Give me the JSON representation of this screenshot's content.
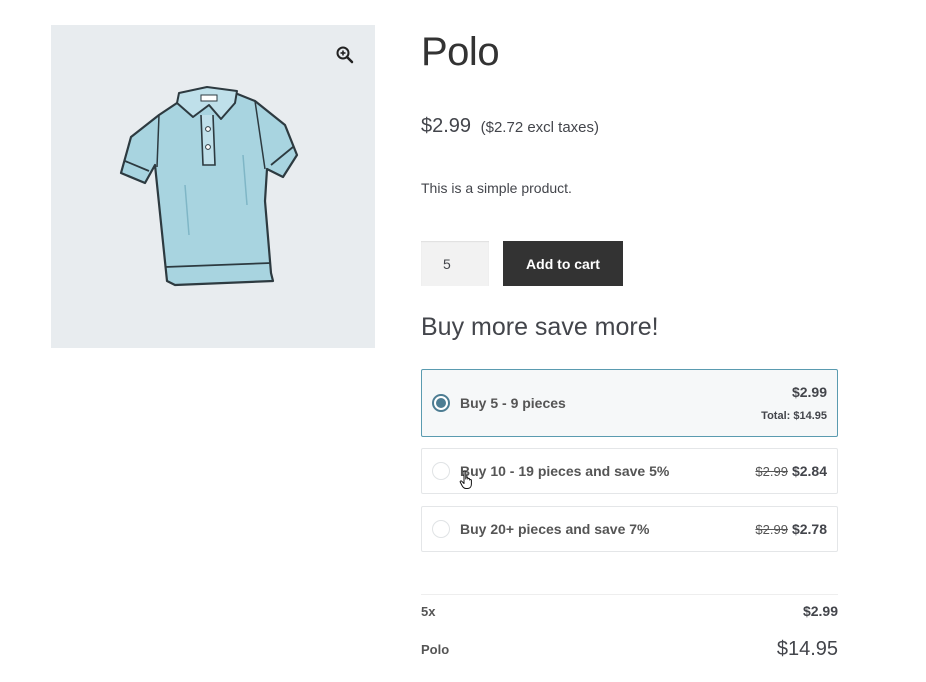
{
  "product": {
    "title": "Polo",
    "price": "$2.99",
    "price_excl": "($2.72 excl taxes)",
    "description": "This is a simple product.",
    "quantity": "5",
    "add_to_cart_label": "Add to cart"
  },
  "tiers": {
    "heading": "Buy more save more!",
    "items": [
      {
        "label": "Buy 5 - 9 pieces",
        "old_price": "",
        "price": "$2.99",
        "total": "Total: $14.95",
        "selected": true
      },
      {
        "label": "Buy 10 - 19 pieces and save 5%",
        "old_price": "$2.99",
        "price": "$2.84",
        "selected": false
      },
      {
        "label": "Buy 20+ pieces and save 7%",
        "old_price": "$2.99",
        "price": "$2.78",
        "selected": false
      }
    ]
  },
  "order_summary": {
    "qty_label": "5x",
    "unit_price": "$2.99",
    "product_label": "Polo",
    "total": "$14.95"
  },
  "icons": {
    "zoom": "zoom-in-icon",
    "cursor": "hand-pointer-icon"
  },
  "colors": {
    "button_bg": "#333333",
    "selected_border": "#5a9bb0",
    "radio_checked": "#4d7d93",
    "image_bg": "#e8ecef",
    "shirt": "#a8d4e0"
  }
}
